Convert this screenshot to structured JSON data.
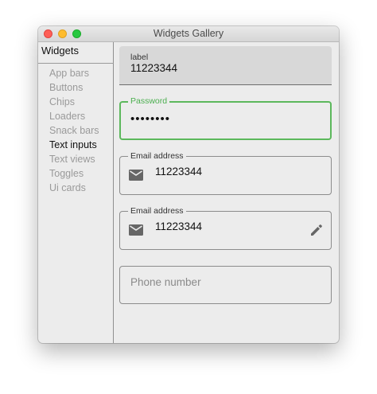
{
  "window": {
    "title": "Widgets Gallery"
  },
  "sidebar": {
    "header": "Widgets",
    "items": [
      {
        "label": "App bars",
        "active": false
      },
      {
        "label": "Buttons",
        "active": false
      },
      {
        "label": "Chips",
        "active": false
      },
      {
        "label": "Loaders",
        "active": false
      },
      {
        "label": "Snack bars",
        "active": false
      },
      {
        "label": "Text inputs",
        "active": true
      },
      {
        "label": "Text views",
        "active": false
      },
      {
        "label": "Toggles",
        "active": false
      },
      {
        "label": "Ui cards",
        "active": false
      }
    ]
  },
  "fields": {
    "filled": {
      "label": "label",
      "value": "11223344"
    },
    "password": {
      "label": "Password",
      "value": "••••••••",
      "accent": "#5cb85c"
    },
    "email1": {
      "label": "Email address",
      "value": "11223344",
      "icon": "mail-icon"
    },
    "email2": {
      "label": "Email address",
      "value": "11223344",
      "icon": "mail-icon",
      "trailing_icon": "edit-icon"
    },
    "phone": {
      "placeholder": "Phone number"
    }
  }
}
